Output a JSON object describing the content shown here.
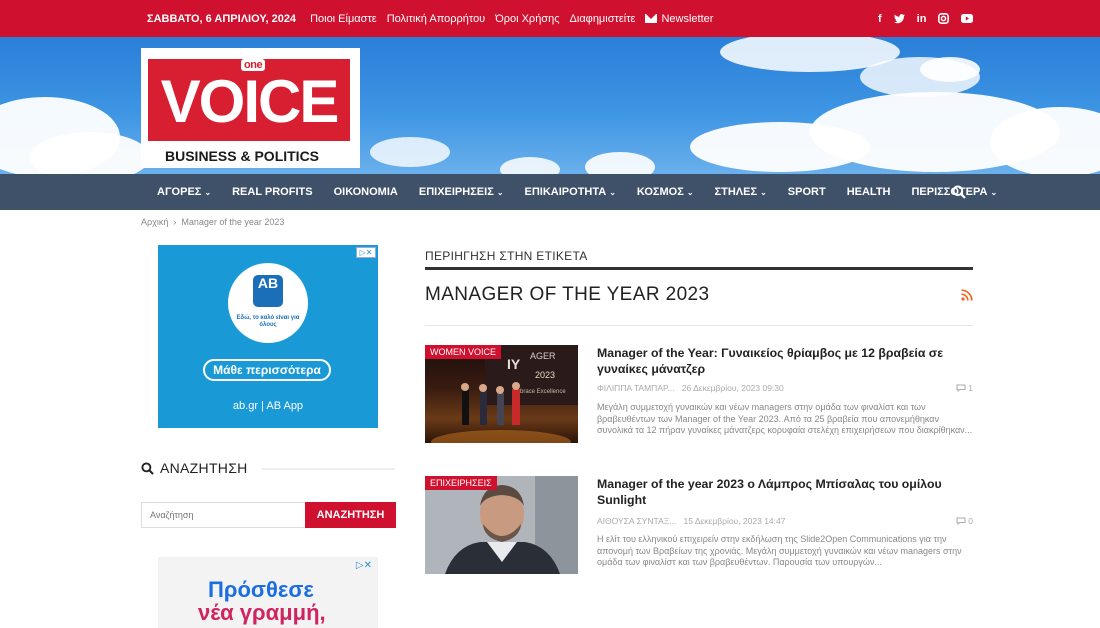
{
  "topbar": {
    "date": "ΣΑΒΒΑΤΟ, 6 ΑΠΡΙΛΙΟΥ, 2024",
    "links": [
      "Ποιοι Είμαστε",
      "Πολιτική Απορρήτου",
      "Όροι Χρήσης",
      "Διαφημιστείτε"
    ],
    "newsletter": "Newsletter",
    "social": [
      "f",
      "y",
      "in",
      "ig",
      "yt"
    ]
  },
  "logo": {
    "one": "one",
    "main": "VOICE",
    "sub": "BUSINESS & POLITICS"
  },
  "nav": {
    "items": [
      {
        "label": "ΑΓΟΡΕΣ",
        "dropdown": true
      },
      {
        "label": "REAL PROFITS",
        "dropdown": false
      },
      {
        "label": "ΟΙΚΟΝΟΜΙΑ",
        "dropdown": false
      },
      {
        "label": "ΕΠΙΧΕΙΡΗΣΕΙΣ",
        "dropdown": true
      },
      {
        "label": "ΕΠΙΚΑΙΡΟΤΗΤΑ",
        "dropdown": true
      },
      {
        "label": "ΚΟΣΜΟΣ",
        "dropdown": true
      },
      {
        "label": "ΣΤΗΛΕΣ",
        "dropdown": true
      },
      {
        "label": "SPORT",
        "dropdown": false
      },
      {
        "label": "HEALTH",
        "dropdown": false
      },
      {
        "label": "ΠΕΡΙΣΣΟΤΕΡΑ",
        "dropdown": true
      }
    ]
  },
  "breadcrumb": {
    "home": "Αρχική",
    "separator": "›",
    "current": "Manager of the year 2023"
  },
  "ad1": {
    "logo_text": "AB",
    "tagline": "Εδώ, το καλό είναι για όλους",
    "cta": "Μάθε περισσότερα",
    "footer": "ab.gr | AB App"
  },
  "sidebar_search": {
    "title": "ΑΝΑΖΗΤΗΣΗ",
    "placeholder": "Αναζήτηση",
    "button": "ΑΝΑΖΗΤΗΣΗ"
  },
  "ad2": {
    "line1": "Πρόσθεσε",
    "line2": "νέα γραμμή,"
  },
  "tag_page": {
    "kicker": "ΠΕΡΙΗΓΗΣΗ ΣΤΗΝ ΕΤΙΚΕΤΑ",
    "title": "MANAGER OF THE YEAR 2023"
  },
  "posts": [
    {
      "category": "WOMEN VOICE",
      "title": "Manager of the Year: Γυναικείος θρίαμβος με 12 βραβεία σε γυναίκες μάνατζερ",
      "author": "ΦΙΛΙΠΠΑ ΤΑΜΠΑΡ...",
      "date": "26 Δεκεμβρίου, 2023 09:30",
      "comments": "1",
      "excerpt": "Μεγάλη συμμετοχή γυναικών και νέων managers στην ομάδα των φιναλίστ και των βραβευθέντων των Manager of the Year 2023. Από τα 25 βραβεία που απονεμήθηκαν συνολικά τα 12 πήραν γυναίκες μάνατζερς κορυφαία στελέχη επιχειρήσεων που διακρίθηκαν..."
    },
    {
      "category": "ΕΠΙΧΕΙΡΗΣΕΙΣ",
      "title": "Manager of the year 2023 ο Λάμπρος Μπίσαλας του ομίλου Sunlight",
      "author": "ΑΙΘΟΥΣΑ ΣΥΝΤΑΞ...",
      "date": "15 Δεκεμβρίου, 2023 14:47",
      "comments": "0",
      "excerpt": "Η ελίτ του ελληνικού επιχειρείν στην εκδήλωση της Slide2Open Communications για την απονομή των Βραβείων της χρονιάς. Μεγάλη συμμετοχή γυναικών και νέων managers στην ομάδα των φιναλίστ και των βραβευθέντων. Παρουσία των υπουργών..."
    }
  ],
  "colors": {
    "brand_red": "#d0102f",
    "nav_bg": "#3e5168",
    "rss_orange": "#f26522"
  }
}
